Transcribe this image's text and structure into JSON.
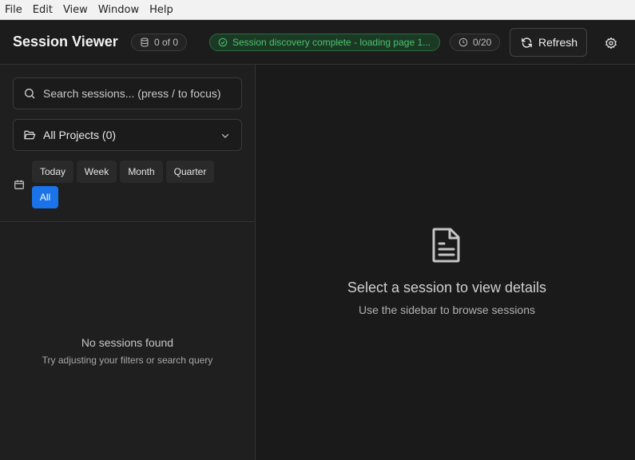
{
  "menu": [
    "File",
    "Edit",
    "View",
    "Window",
    "Help"
  ],
  "header": {
    "title": "Session Viewer",
    "count_badge": "0 of 0",
    "status_text": "Session discovery complete - loading page 1...",
    "timer_badge": "0/20",
    "refresh_label": "Refresh"
  },
  "sidebar": {
    "search_placeholder": "Search sessions... (press / to focus)",
    "project_selected": "All Projects (0)",
    "ranges": [
      "Today",
      "Week",
      "Month",
      "Quarter",
      "All"
    ],
    "active_range": "All",
    "empty_title": "No sessions found",
    "empty_subtitle": "Try adjusting your filters or search query"
  },
  "main": {
    "empty_title": "Select a session to view details",
    "empty_subtitle": "Use the sidebar to browse sessions"
  },
  "colors": {
    "accent": "#1a73e8",
    "status_green": "#4cc26e",
    "background": "#1a1a1a"
  },
  "icons": [
    "database-icon",
    "check-circle-icon",
    "clock-icon",
    "refresh-icon",
    "gear-icon",
    "search-icon",
    "folder-icon",
    "chevron-down-icon",
    "calendar-icon",
    "document-icon"
  ]
}
